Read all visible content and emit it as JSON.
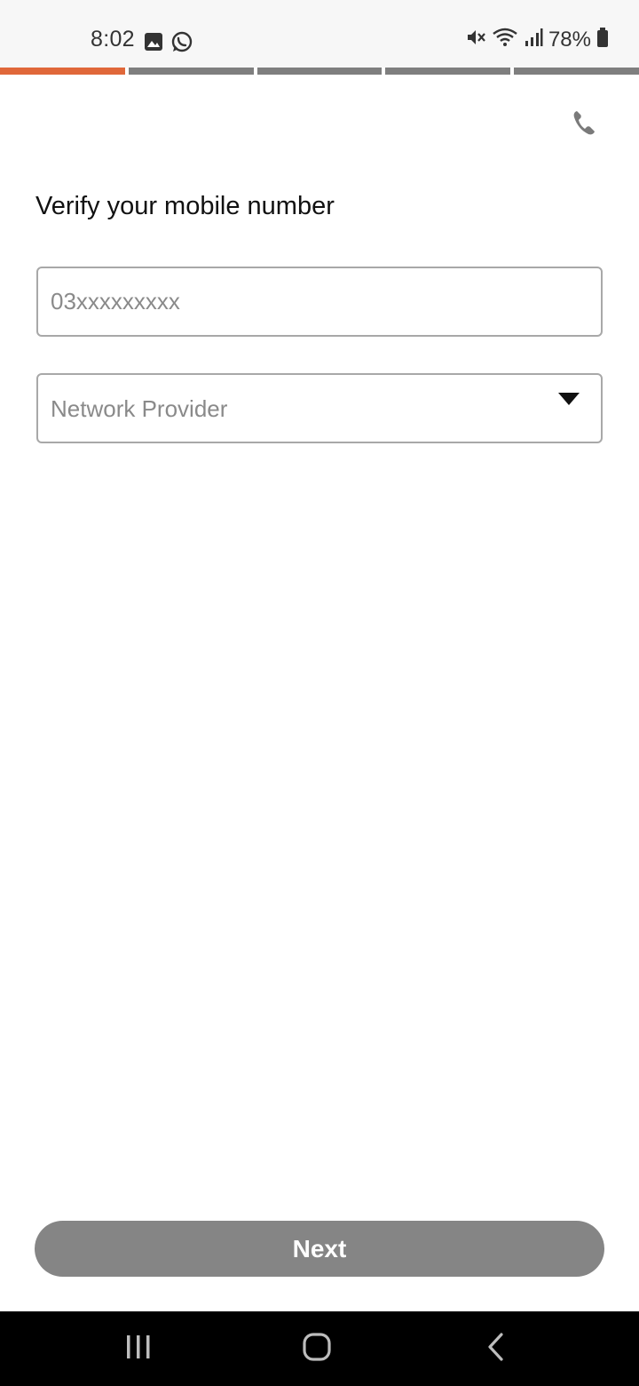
{
  "status_bar": {
    "time": "8:02",
    "battery_text": "78%",
    "icons": [
      "gallery-icon",
      "whatsapp-icon",
      "mute-icon",
      "wifi-icon",
      "signal-icon",
      "battery-icon"
    ]
  },
  "progress": {
    "total_steps": 5,
    "current_step": 1,
    "active_color": "#e0683a",
    "inactive_color": "#7f7f7f"
  },
  "header": {
    "call_icon": "phone-icon"
  },
  "form": {
    "title": "Verify your mobile number",
    "phone": {
      "value": "",
      "placeholder": "03xxxxxxxxx"
    },
    "network": {
      "selected": "Network Provider",
      "icon": "chevron-down-icon"
    }
  },
  "footer": {
    "next_label": "Next",
    "next_color": "#858585"
  },
  "nav_bar": {
    "buttons": [
      "recents-icon",
      "home-icon",
      "back-icon"
    ]
  }
}
